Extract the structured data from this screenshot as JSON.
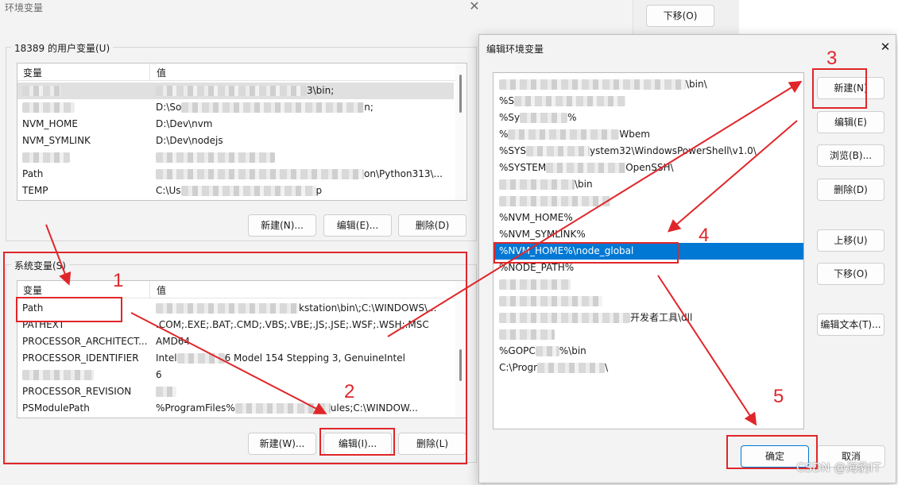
{
  "left_window": {
    "title": "环境变量",
    "close_glyph": "✕",
    "user_vars": {
      "group_label": "18389 的用户变量(U)",
      "col_name": "变量",
      "col_value": "值",
      "rows": [
        {
          "name": "",
          "value": "3\\bin;",
          "blurred": true
        },
        {
          "name": "",
          "value": "D:\\So",
          "value2": "n;",
          "blurred": true
        },
        {
          "name": "NVM_HOME",
          "value": "D:\\Dev\\nvm"
        },
        {
          "name": "NVM_SYMLINK",
          "value": "D:\\Dev\\nodejs"
        },
        {
          "name": "",
          "value": "",
          "blurred": true
        },
        {
          "name": "Path",
          "value": "on\\Python313\\...",
          "blurred": true
        },
        {
          "name": "TEMP",
          "value": "C:\\Us",
          "value2": "p",
          "blurred": true
        }
      ],
      "buttons": {
        "new": "新建(N)...",
        "edit": "编辑(E)...",
        "delete": "删除(D)"
      }
    },
    "system_vars": {
      "group_label": "系统变量(S)",
      "col_name": "变量",
      "col_value": "值",
      "rows": [
        {
          "name": "Path",
          "value": "kstation\\bin\\;C:\\WINDOWS\\...",
          "blurred": true
        },
        {
          "name": "PATHEXT",
          "value": ".COM;.EXE;.BAT;.CMD;.VBS;.VBE;.JS;.JSE;.WSF;.WSH;.MSC"
        },
        {
          "name": "PROCESSOR_ARCHITECT...",
          "value": "AMD64"
        },
        {
          "name": "PROCESSOR_IDENTIFIER",
          "value": "Intel",
          "value2": "6 Model 154 Stepping 3, GenuineIntel"
        },
        {
          "name": "",
          "value": "6",
          "blurred": true
        },
        {
          "name": "PROCESSOR_REVISION",
          "value": "",
          "blurred": true
        },
        {
          "name": "PSModulePath",
          "value": "%ProgramFiles%",
          "value2": "ules;C:\\WINDOW..."
        }
      ],
      "buttons": {
        "new": "新建(W)...",
        "edit": "编辑(I)...",
        "delete": "删除(L)"
      }
    }
  },
  "background": {
    "move_down": "下移(O)"
  },
  "dialog": {
    "title": "编辑环境变量",
    "close_glyph": "✕",
    "items": [
      {
        "text": "\\bin\\",
        "blurred": true
      },
      {
        "text": "%S",
        "tail": "",
        "blurred": true
      },
      {
        "text": "%Sy",
        "tail": "%",
        "blurred": true
      },
      {
        "text": "%",
        "tail": "Wbem",
        "blurred": true
      },
      {
        "text": "%SYS",
        "tail": "ystem32\\WindowsPowerShell\\v1.0\\",
        "blurred": true
      },
      {
        "text": "%SYSTEM",
        "tail": "OpenSSH\\",
        "blurred": true
      },
      {
        "text": "",
        "tail": "\\bin",
        "blurred": true
      },
      {
        "text": "",
        "tail": "",
        "blurred": true
      },
      {
        "text": "%NVM_HOME%"
      },
      {
        "text": "%NVM_SYMLINK%"
      },
      {
        "text": "%NVM_HOME%\\node_global",
        "selected": true
      },
      {
        "text": "%NODE_PATH%"
      },
      {
        "text": "",
        "tail": "",
        "blurred": true
      },
      {
        "text": "",
        "tail": "",
        "blurred": true
      },
      {
        "text": "",
        "tail": "开发者工具\\dll",
        "blurred": true
      },
      {
        "text": "",
        "tail": "",
        "blurred": true
      },
      {
        "text": "%GOPC",
        "tail": "%\\bin",
        "blurred": true
      },
      {
        "text": "C:\\Progr",
        "tail": "\\",
        "blurred": true
      }
    ],
    "buttons": {
      "new": "新建(N)",
      "edit": "编辑(E)",
      "browse": "浏览(B)...",
      "delete": "删除(D)",
      "move_up": "上移(U)",
      "move_down": "下移(O)",
      "edit_text": "编辑文本(T)...",
      "ok": "确定",
      "cancel": "取消"
    }
  },
  "annotations": {
    "steps": [
      "1",
      "2",
      "3",
      "4",
      "5"
    ],
    "color": "#e0262a"
  },
  "watermark": "CSDN @海豹IT",
  "colors": {
    "selection": "#0078d4",
    "annotation": "#e0262a",
    "window_bg": "#f3f3f3"
  }
}
